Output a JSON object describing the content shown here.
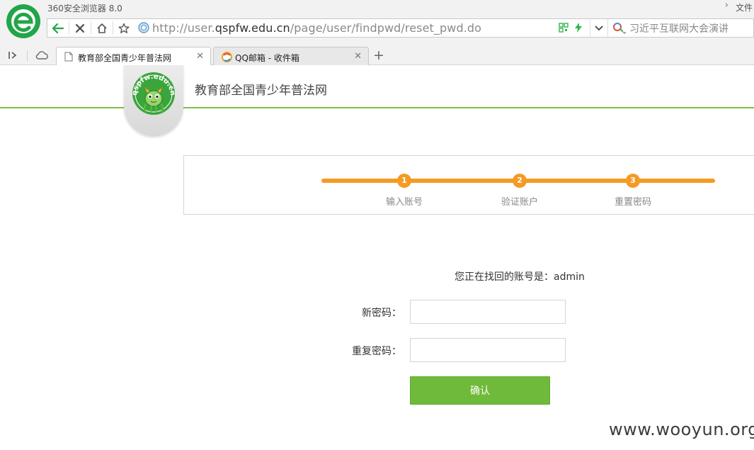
{
  "browser": {
    "app_title": "360安全浏览器 8.0",
    "file_menu": "文件",
    "url_prefix": "http://user.",
    "url_domain": "qspfw.edu.cn",
    "url_path": "/page/user/findpwd/reset_pwd.do",
    "search_text": "习近平互联网大会演讲",
    "tabs": [
      {
        "label": "教育部全国青少年普法网",
        "active": true
      },
      {
        "label": "QQ邮箱 - 收件箱",
        "active": false
      }
    ],
    "brand_color": "#23a54a",
    "speed_icon_color": "#2db84d"
  },
  "site": {
    "name": "教育部全国青少年普法网",
    "logo_text": "qspfw.edu.cn",
    "accent_color": "#7cc04a"
  },
  "steps": [
    {
      "number": "1",
      "label": "输入账号"
    },
    {
      "number": "2",
      "label": "验证账户"
    },
    {
      "number": "3",
      "label": "重置密码"
    }
  ],
  "steps_color": "#f59a23",
  "form": {
    "account_prefix": "您正在找回的账号是：",
    "account_name": "admin",
    "new_password_label": "新密码：",
    "repeat_password_label": "重复密码：",
    "new_password_value": "",
    "repeat_password_value": "",
    "confirm_label": "确认",
    "button_color": "#6fba3a"
  },
  "watermark": "www.wooyun.org"
}
